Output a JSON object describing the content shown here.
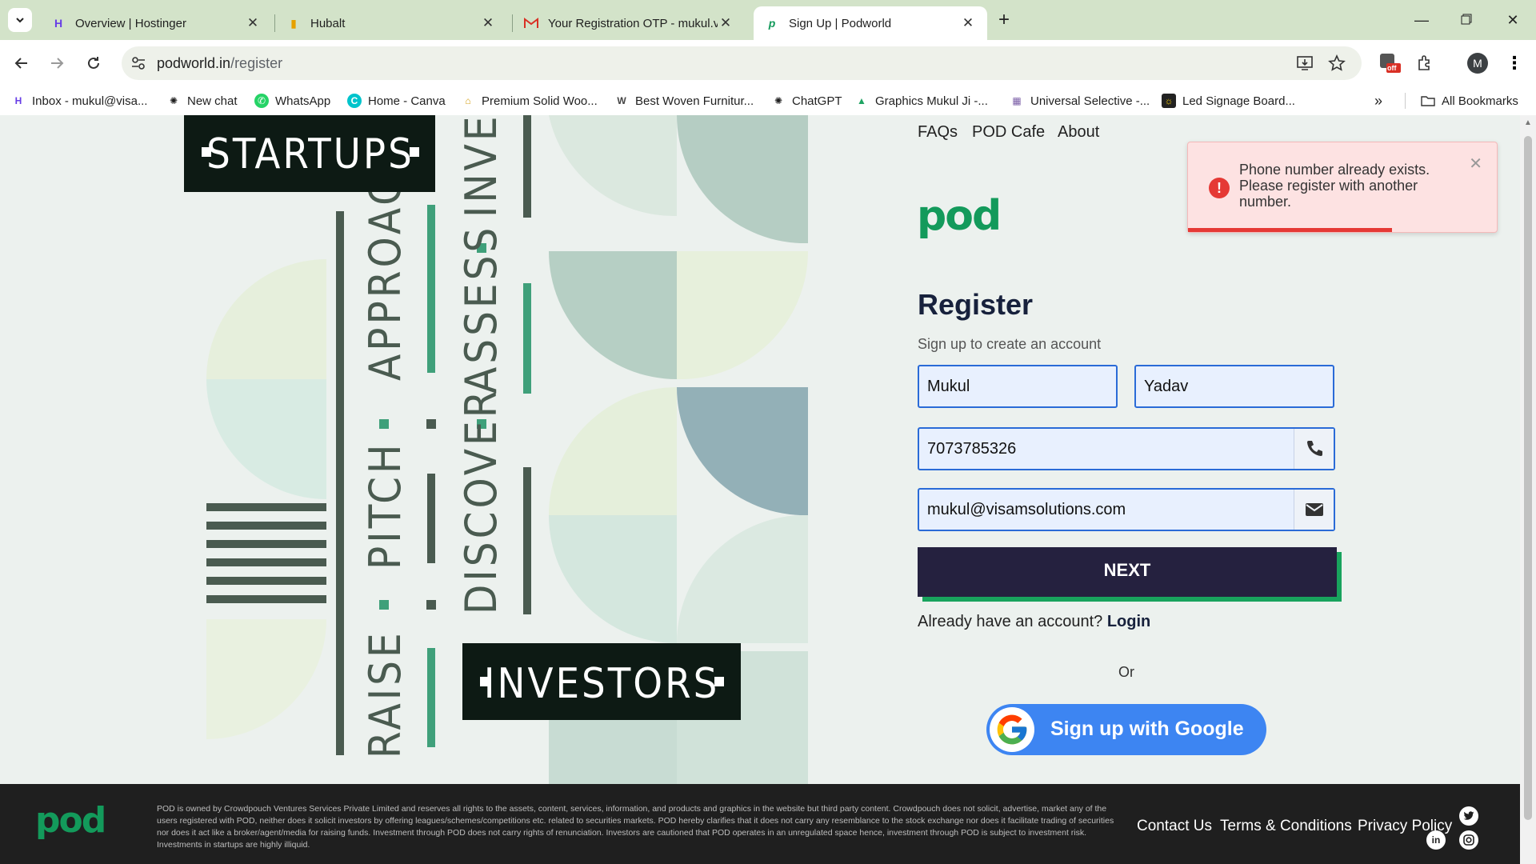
{
  "browser": {
    "tabs": [
      {
        "title": "Overview | Hostinger",
        "icon": "hostinger-icon"
      },
      {
        "title": "Hubalt",
        "icon": "hubalt-icon"
      },
      {
        "title": "Your Registration OTP - mukul.v",
        "icon": "gmail-icon"
      },
      {
        "title": "Sign Up | Podworld",
        "icon": "podworld-icon",
        "active": true
      }
    ],
    "url_domain": "podworld.in",
    "url_path": "/register",
    "profile_initial": "M",
    "extension_badge": "off",
    "bookmarks": [
      "Inbox - mukul@visa...",
      "New chat",
      "WhatsApp",
      "Home - Canva",
      "Premium Solid Woo...",
      "Best Woven Furnitur...",
      "ChatGPT",
      "Graphics Mukul Ji -...",
      "Universal Selective -...",
      "Led Signage Board..."
    ],
    "all_bookmarks": "All Bookmarks"
  },
  "hero": {
    "startups": "STARTUPS",
    "investors": "INVESTORS",
    "words": [
      "APPROACH",
      "PITCH",
      "RAISE",
      "INVEST",
      "ASSESS",
      "DISCOVER"
    ]
  },
  "nav": {
    "faqs": "FAQs",
    "pod_cafe": "POD Cafe",
    "about": "About"
  },
  "logo": "pod",
  "form": {
    "title": "Register",
    "subtitle": "Sign up to create an account",
    "first_name": "Mukul",
    "last_name": "Yadav",
    "phone": "7073785326",
    "email": "mukul@visamsolutions.com",
    "next": "NEXT",
    "have_account": "Already have an account?",
    "login": "Login",
    "or": "Or",
    "google": "Sign up with Google"
  },
  "toast": {
    "message": "Phone number already exists. Please register with another number.",
    "progress": 0.66,
    "color": "#e53935"
  },
  "footer": {
    "legal": "POD is owned by Crowdpouch Ventures Services Private Limited and reserves all rights to the assets, content, services, information, and products and graphics in the website but third party content. Crowdpouch does not solicit, advertise, market any of the users registered with POD, neither does it solicit investors by offering leagues/schemes/competitions etc. related to securities markets. POD hereby clarifies that it does not carry any resemblance to the stock exchange nor does it facilitate trading of securities nor does it act like a broker/agent/media for raising funds. Investment through POD does not carry rights of renunciation. Investors are cautioned that POD operates in an unregulated space hence, investment through POD is subject to investment risk. Investments in startups are highly illiquid.",
    "contact": "Contact Us",
    "terms": "Terms & Conditions",
    "privacy": "Privacy Policy"
  },
  "colors": {
    "brand_green": "#139a5b",
    "button_dark": "#25213f",
    "google_blue": "#3d85f2"
  }
}
